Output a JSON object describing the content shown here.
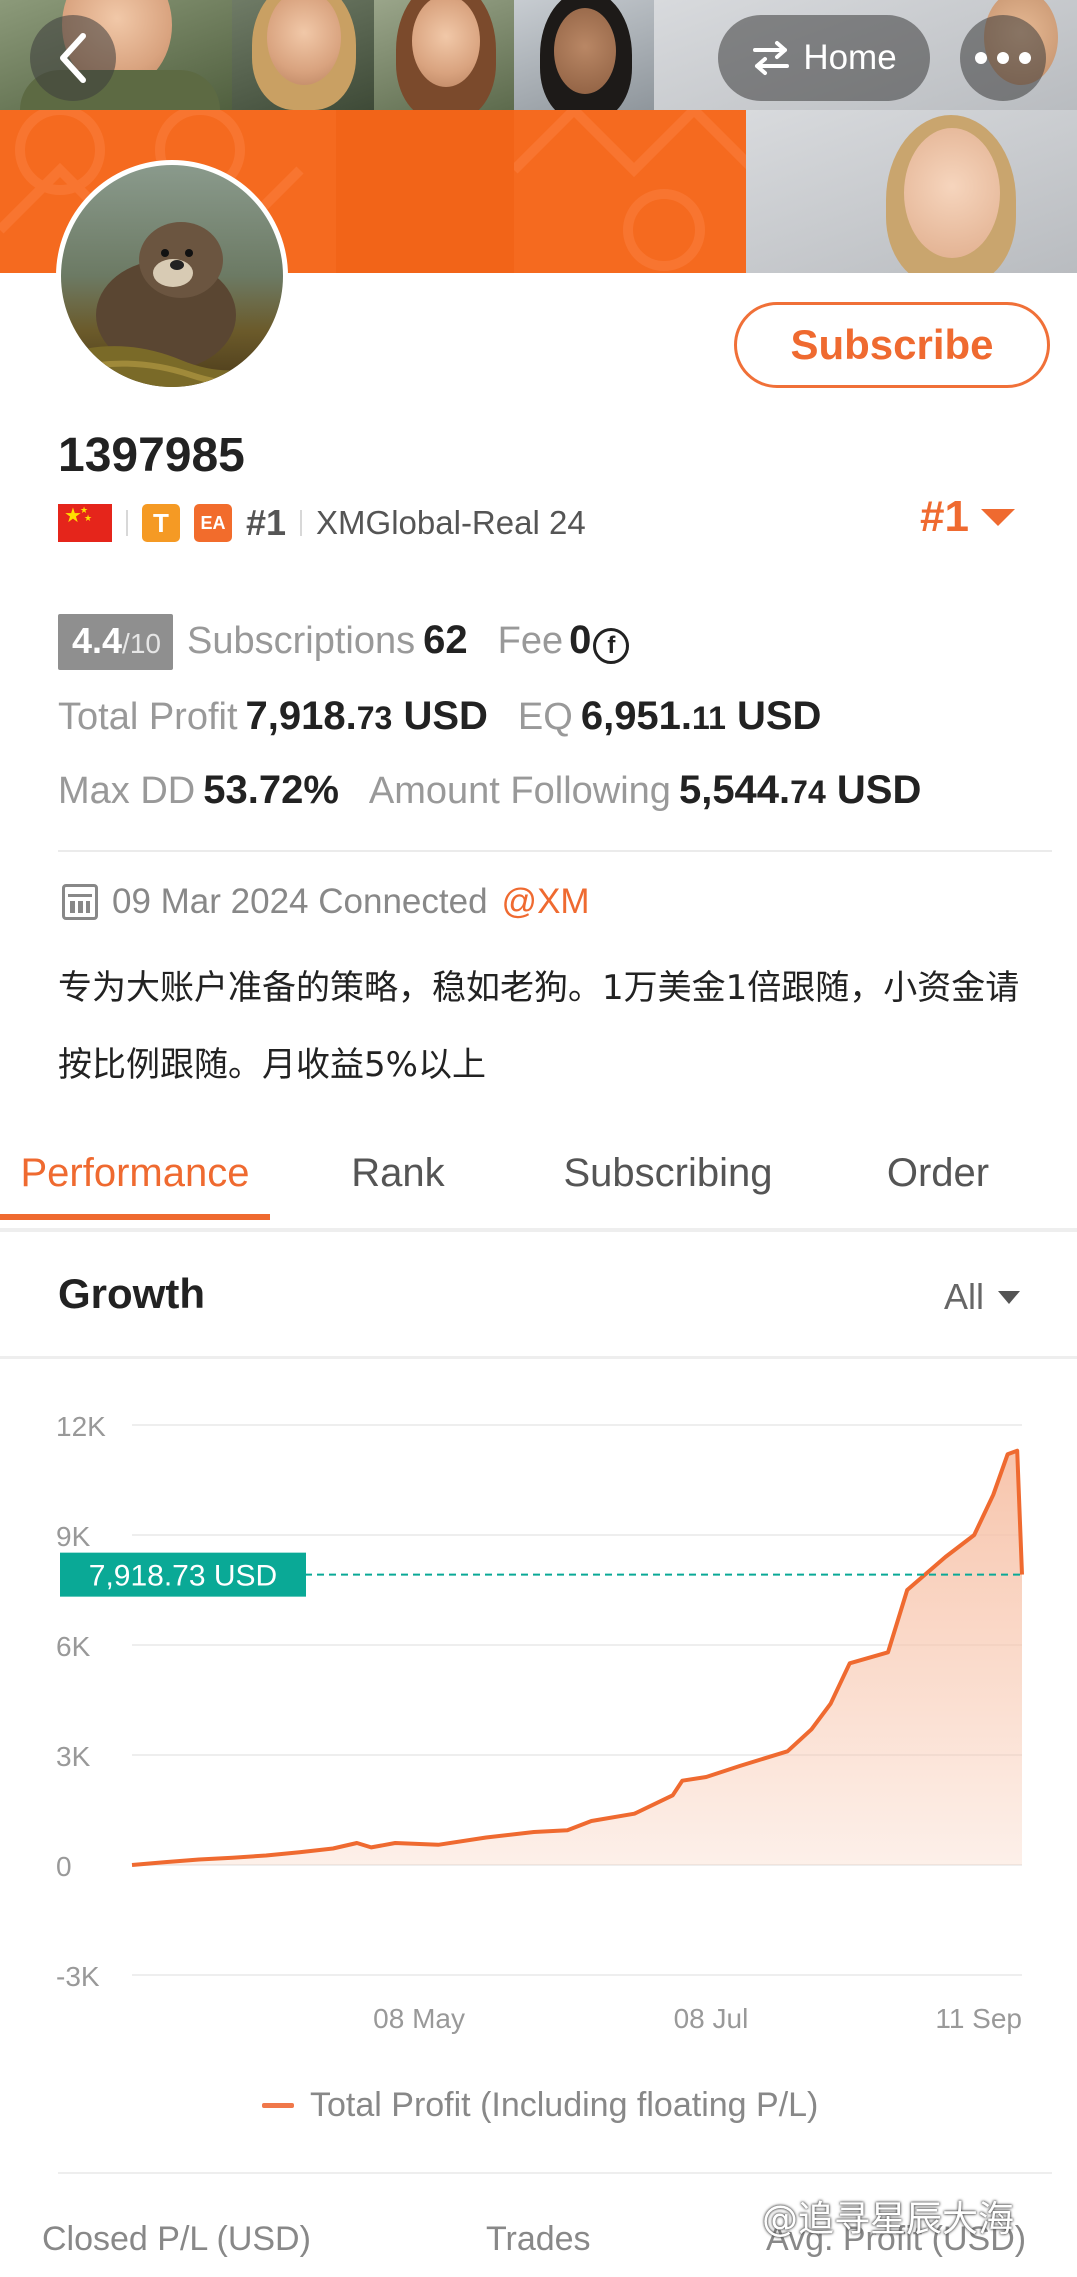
{
  "header": {
    "home_label": "Home"
  },
  "profile": {
    "user_id": "1397985",
    "subscribe_label": "Subscribe",
    "tag_t": "T",
    "tag_ea": "EA",
    "rank_small": "#1",
    "server": "XMGlobal-Real 24",
    "rank_big": "#1"
  },
  "stats": {
    "score": "4.4",
    "score_max": "/10",
    "subscriptions_label": "Subscriptions",
    "subscriptions_value": "62",
    "fee_label": "Fee",
    "fee_value": "0",
    "fee_icon_glyph": "f",
    "total_profit_label": "Total Profit",
    "total_profit_int": "7,918.",
    "total_profit_dec": "73",
    "total_profit_unit": " USD",
    "eq_label": "EQ",
    "eq_int": "6,951.",
    "eq_dec": "11",
    "eq_unit": " USD",
    "max_dd_label": "Max DD",
    "max_dd_value": "53.72%",
    "amount_following_label": "Amount Following",
    "amount_following_int": "5,544.",
    "amount_following_dec": "74",
    "amount_following_unit": " USD"
  },
  "info": {
    "connected_date": "09 Mar 2024 Connected",
    "broker": "@XM",
    "description": "专为大账户准备的策略，稳如老狗。1万美金1倍跟随，小资金请按比例跟随。月收益5%以上"
  },
  "tabs": [
    {
      "label": "Performance",
      "active": true
    },
    {
      "label": "Rank",
      "active": false
    },
    {
      "label": "Subscribing",
      "active": false
    },
    {
      "label": "Order",
      "active": false
    }
  ],
  "growth": {
    "title": "Growth",
    "range": "All"
  },
  "chart_data": {
    "type": "area",
    "xlabel": "",
    "ylabel": "",
    "y_ticks": [
      "12K",
      "9K",
      "6K",
      "3K",
      "0",
      "-3K"
    ],
    "x_ticks": [
      "08 May",
      "08 Jul",
      "11 Sep"
    ],
    "ylim": [
      -3000,
      12000
    ],
    "x_range": [
      "2024-03-09",
      "2024-09-11"
    ],
    "current_value_label": "7,918.73 USD",
    "current_value": 7918.73,
    "series": [
      {
        "name": "Total Profit (Including floating P/L)",
        "points": [
          [
            "2024-03-09",
            0
          ],
          [
            "2024-03-16",
            80
          ],
          [
            "2024-03-23",
            150
          ],
          [
            "2024-03-30",
            200
          ],
          [
            "2024-04-06",
            260
          ],
          [
            "2024-04-13",
            350
          ],
          [
            "2024-04-20",
            450
          ],
          [
            "2024-04-25",
            600
          ],
          [
            "2024-04-28",
            480
          ],
          [
            "2024-05-03",
            600
          ],
          [
            "2024-05-12",
            550
          ],
          [
            "2024-05-22",
            750
          ],
          [
            "2024-06-01",
            900
          ],
          [
            "2024-06-08",
            950
          ],
          [
            "2024-06-13",
            1200
          ],
          [
            "2024-06-22",
            1400
          ],
          [
            "2024-06-30",
            1900
          ],
          [
            "2024-07-02",
            2300
          ],
          [
            "2024-07-07",
            2400
          ],
          [
            "2024-07-14",
            2700
          ],
          [
            "2024-07-24",
            3100
          ],
          [
            "2024-07-29",
            3700
          ],
          [
            "2024-08-02",
            4400
          ],
          [
            "2024-08-06",
            5500
          ],
          [
            "2024-08-14",
            5800
          ],
          [
            "2024-08-18",
            7500
          ],
          [
            "2024-08-26",
            8400
          ],
          [
            "2024-09-01",
            9000
          ],
          [
            "2024-09-05",
            10100
          ],
          [
            "2024-09-08",
            11200
          ],
          [
            "2024-09-10",
            11300
          ],
          [
            "2024-09-11",
            7918.73
          ]
        ]
      }
    ],
    "grid": true,
    "legend_position": "bottom-center",
    "line_color": "#ef6a30",
    "fill_color": "#f7c2a8",
    "marker_color": "#0aa996"
  },
  "legend": {
    "label": "Total Profit (Including floating P/L)"
  },
  "footer": {
    "closed_pl": "Closed P/L (USD)",
    "trades": "Trades",
    "avg_profit": "Avg. Profit (USD)",
    "watermark": "@追寻星辰大海"
  },
  "colors": {
    "accent": "#ef6a30",
    "banner_orange": "#f56a1f",
    "marker": "#0aa996"
  }
}
